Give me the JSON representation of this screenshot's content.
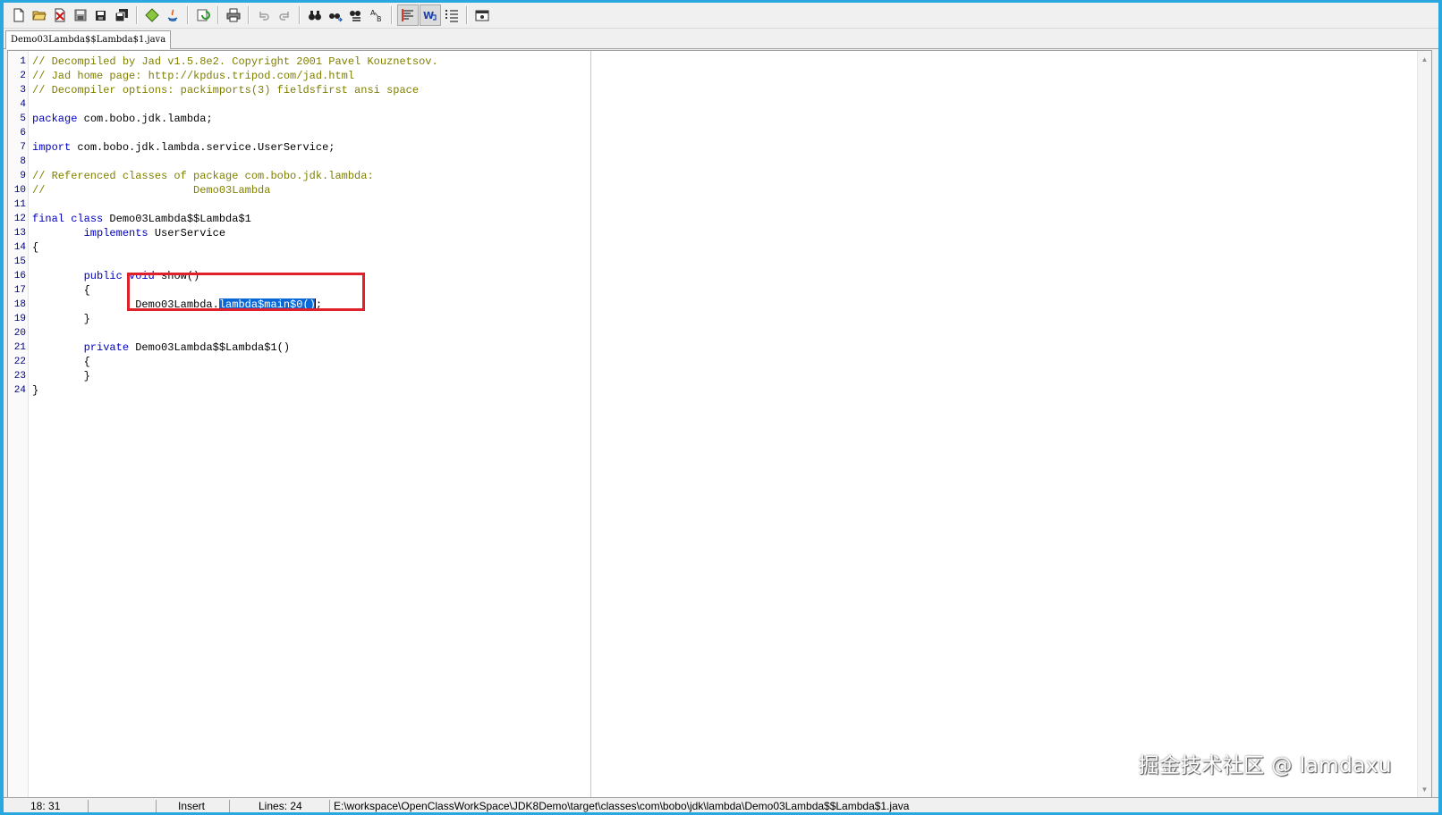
{
  "tab": {
    "filename": "Demo03Lambda$$Lambda$1.java"
  },
  "toolbar": {
    "buttons": [
      "new-file-icon",
      "open-folder-icon",
      "close-file-icon",
      "save-icon",
      "save-as-icon",
      "save-all-icon",
      "decompile-icon",
      "java-icon",
      "refresh-icon",
      "print-icon",
      "undo-icon",
      "redo-icon",
      "find-icon",
      "find-next-icon",
      "replace-icon",
      "goto-icon",
      "format-icon",
      "word-wrap-icon",
      "line-numbers-icon",
      "settings-icon"
    ]
  },
  "code": {
    "lines": [
      {
        "num": "1",
        "parts": [
          {
            "t": "comment",
            "v": "// Decompiled by Jad v1.5.8e2. Copyright 2001 Pavel Kouznetsov."
          }
        ]
      },
      {
        "num": "2",
        "parts": [
          {
            "t": "comment",
            "v": "// Jad home page: http://kpdus.tripod.com/jad.html"
          }
        ]
      },
      {
        "num": "3",
        "parts": [
          {
            "t": "comment",
            "v": "// Decompiler options: packimports(3) fieldsfirst ansi space"
          }
        ]
      },
      {
        "num": "4",
        "parts": []
      },
      {
        "num": "5",
        "parts": [
          {
            "t": "kw",
            "v": "package"
          },
          {
            "t": "plain",
            "v": " com.bobo.jdk.lambda;"
          }
        ]
      },
      {
        "num": "6",
        "parts": []
      },
      {
        "num": "7",
        "parts": [
          {
            "t": "kw",
            "v": "import"
          },
          {
            "t": "plain",
            "v": " com.bobo.jdk.lambda.service.UserService;"
          }
        ]
      },
      {
        "num": "8",
        "parts": []
      },
      {
        "num": "9",
        "parts": [
          {
            "t": "comment",
            "v": "// Referenced classes of package com.bobo.jdk.lambda:"
          }
        ]
      },
      {
        "num": "10",
        "parts": [
          {
            "t": "comment",
            "v": "//                       Demo03Lambda"
          }
        ]
      },
      {
        "num": "11",
        "parts": []
      },
      {
        "num": "12",
        "parts": [
          {
            "t": "kw",
            "v": "final"
          },
          {
            "t": "plain",
            "v": " "
          },
          {
            "t": "kw",
            "v": "class"
          },
          {
            "t": "plain",
            "v": " Demo03Lambda$$Lambda$1"
          }
        ]
      },
      {
        "num": "13",
        "parts": [
          {
            "t": "plain",
            "v": "        "
          },
          {
            "t": "kw",
            "v": "implements"
          },
          {
            "t": "plain",
            "v": " UserService"
          }
        ]
      },
      {
        "num": "14",
        "parts": [
          {
            "t": "plain",
            "v": "{"
          }
        ]
      },
      {
        "num": "15",
        "parts": []
      },
      {
        "num": "16",
        "parts": [
          {
            "t": "plain",
            "v": "        "
          },
          {
            "t": "kw",
            "v": "public"
          },
          {
            "t": "plain",
            "v": " "
          },
          {
            "t": "kw",
            "v": "void"
          },
          {
            "t": "plain",
            "v": " show()"
          }
        ]
      },
      {
        "num": "17",
        "parts": [
          {
            "t": "plain",
            "v": "        {"
          }
        ]
      },
      {
        "num": "18",
        "parts": [
          {
            "t": "plain",
            "v": "                Demo03Lambda."
          },
          {
            "t": "sel",
            "v": "lambda$main$0()"
          },
          {
            "t": "cursor",
            "v": ""
          },
          {
            "t": "plain",
            "v": ";"
          }
        ]
      },
      {
        "num": "19",
        "parts": [
          {
            "t": "plain",
            "v": "        }"
          }
        ]
      },
      {
        "num": "20",
        "parts": []
      },
      {
        "num": "21",
        "parts": [
          {
            "t": "plain",
            "v": "        "
          },
          {
            "t": "kw",
            "v": "private"
          },
          {
            "t": "plain",
            "v": " Demo03Lambda$$Lambda$1()"
          }
        ]
      },
      {
        "num": "22",
        "parts": [
          {
            "t": "plain",
            "v": "        {"
          }
        ]
      },
      {
        "num": "23",
        "parts": [
          {
            "t": "plain",
            "v": "        }"
          }
        ]
      },
      {
        "num": "24",
        "parts": [
          {
            "t": "plain",
            "v": "}"
          }
        ]
      }
    ]
  },
  "status": {
    "position": "18: 31",
    "blank": "",
    "mode": "Insert",
    "lines": "Lines: 24",
    "path": "E:\\workspace\\OpenClassWorkSpace\\JDK8Demo\\target\\classes\\com\\bobo\\jdk\\lambda\\Demo03Lambda$$Lambda$1.java"
  },
  "watermark": "掘金技术社区 @ lamdaxu",
  "colors": {
    "comment": "#808000",
    "keyword": "#0000c0",
    "selection": "#0a68d6",
    "highlight_box": "#e0202a"
  }
}
